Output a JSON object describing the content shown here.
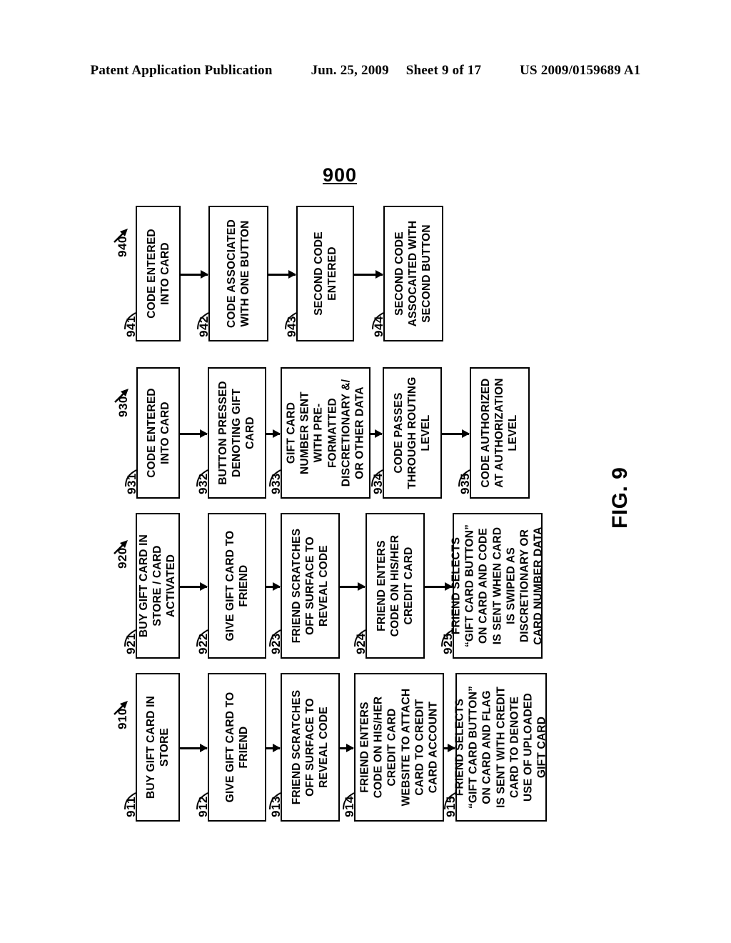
{
  "header": {
    "publication": "Patent Application Publication",
    "date": "Jun. 25, 2009",
    "sheet": "Sheet 9 of 17",
    "patent_number": "US 2009/0159689 A1"
  },
  "figure": {
    "id": "900",
    "caption": "FIG. 9",
    "type": "flowchart",
    "orientation": "rotated-90-ccw"
  },
  "flows": [
    {
      "series": "940",
      "steps": [
        {
          "ref": "941",
          "lines": [
            "CODE ENTERED",
            "INTO CARD"
          ]
        },
        {
          "ref": "942",
          "lines": [
            "CODE ASSOCIATED",
            "WITH ONE BUTTON"
          ]
        },
        {
          "ref": "943",
          "lines": [
            "SECOND CODE",
            "ENTERED"
          ]
        },
        {
          "ref": "944",
          "lines": [
            "SECOND CODE",
            "ASSOCAITED WITH",
            "SECOND BUTTON"
          ]
        }
      ]
    },
    {
      "series": "930",
      "steps": [
        {
          "ref": "931",
          "lines": [
            "CODE ENTERED",
            "INTO CARD"
          ]
        },
        {
          "ref": "932",
          "lines": [
            "BUTTON PRESSED",
            "DENOTING GIFT",
            "CARD"
          ]
        },
        {
          "ref": "933",
          "lines": [
            "GIFT CARD",
            "NUMBER SENT",
            "WITH PRE-",
            "FORMATTED",
            "DISCRETIONARY &/",
            "OR OTHER DATA"
          ]
        },
        {
          "ref": "934",
          "lines": [
            "CODE PASSES",
            "THROUGH ROUTING",
            "LEVEL"
          ]
        },
        {
          "ref": "935",
          "lines": [
            "CODE AUTHORIZED",
            "AT AUTHORIZATION",
            "LEVEL"
          ]
        }
      ]
    },
    {
      "series": "920",
      "steps": [
        {
          "ref": "921",
          "lines": [
            "BUY GIFT CARD IN",
            "STORE / CARD",
            "ACTIVATED"
          ]
        },
        {
          "ref": "922",
          "lines": [
            "GIVE GIFT CARD TO",
            "FRIEND"
          ]
        },
        {
          "ref": "923",
          "lines": [
            "FRIEND SCRATCHES",
            "OFF SURFACE TO",
            "REVEAL CODE"
          ]
        },
        {
          "ref": "924",
          "lines": [
            "FRIEND ENTERS",
            "CODE ON HIS/HER",
            "CREDIT CARD"
          ]
        },
        {
          "ref": "925",
          "lines": [
            "FRIEND SELECTS",
            "“GIFT CARD BUTTON”",
            "ON CARD AND CODE",
            "IS SENT WHEN CARD",
            "IS SWIPED AS",
            "DISCRETIONARY OR",
            "CARD NUMBER DATA"
          ]
        }
      ]
    },
    {
      "series": "910",
      "steps": [
        {
          "ref": "911",
          "lines": [
            "BUY GIFT CARD IN",
            "STORE"
          ]
        },
        {
          "ref": "912",
          "lines": [
            "GIVE GIFT CARD TO",
            "FRIEND"
          ]
        },
        {
          "ref": "913",
          "lines": [
            "FRIEND SCRATCHES",
            "OFF SURFACE TO",
            "REVEAL CODE"
          ]
        },
        {
          "ref": "914",
          "lines": [
            "FRIEND ENTERS",
            "CODE ON HIS/HER",
            "CREDIT CARD",
            "WEBSITE TO ATTACH",
            "CARD TO CREDIT",
            "CARD ACCOUNT"
          ]
        },
        {
          "ref": "915",
          "lines": [
            "FRIEND SELECTS",
            "“GIFT CARD BUTTON”",
            "ON CARD AND FLAG",
            "IS SENT WITH CREDIT",
            "CARD TO DENOTE",
            "USE OF UPLOADED",
            "GIFT CARD"
          ]
        }
      ]
    }
  ]
}
